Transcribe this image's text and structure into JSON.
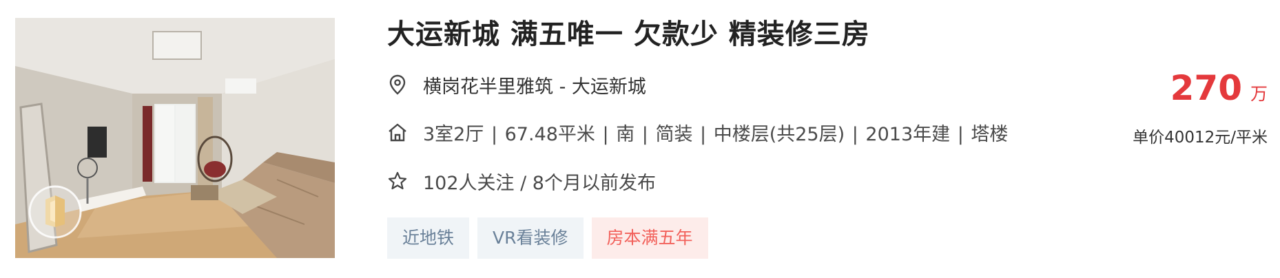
{
  "listing": {
    "title": "大运新城 满五唯一 欠款少 精装修三房",
    "photo": {
      "icon": "vr-badge-icon"
    },
    "location": {
      "icon": "location-pin-icon",
      "community": "横岗花半里雅筑",
      "separator": " - ",
      "district": "大运新城"
    },
    "house_info": {
      "icon": "house-icon",
      "items": [
        "3室2厅",
        "67.48平米",
        "南",
        "简装",
        "中楼层(共25层)",
        "2013年建",
        "塔楼"
      ],
      "separator": " | "
    },
    "follow_info": {
      "icon": "star-icon",
      "text": "102人关注 / 8个月以前发布"
    },
    "tags": [
      {
        "label": "近地铁",
        "style": "blue"
      },
      {
        "label": "VR看装修",
        "style": "blue"
      },
      {
        "label": "房本满五年",
        "style": "red"
      }
    ],
    "price": {
      "total": "270",
      "unit": "万",
      "per_sqm": "单价40012元/平米"
    },
    "colors": {
      "price_red": "#e4393c",
      "tag_blue_bg": "#f0f4f7",
      "tag_blue_text": "#6a8199",
      "tag_red_bg": "#fdecea",
      "tag_red_text": "#f2605a"
    }
  }
}
